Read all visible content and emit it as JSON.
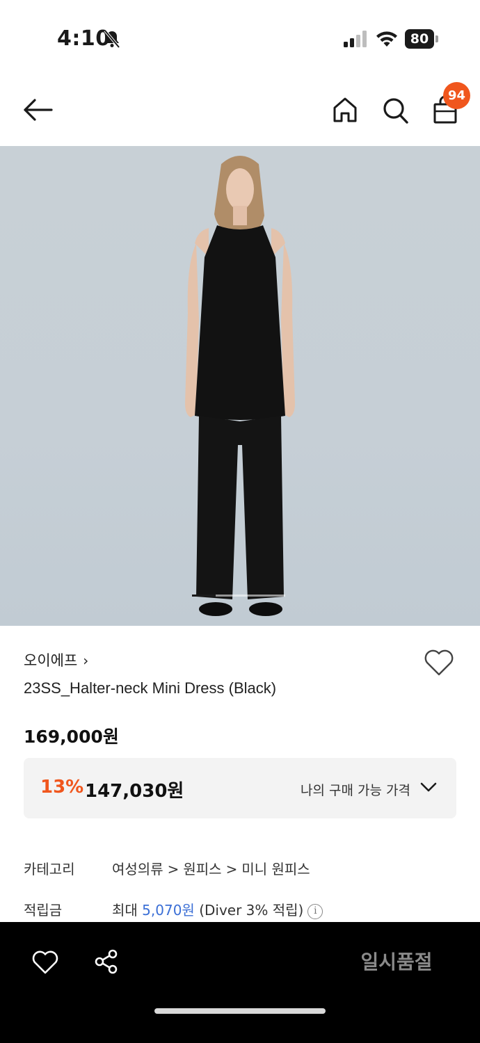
{
  "status_bar": {
    "time": "4:10",
    "battery": "80"
  },
  "header": {
    "cart_count": "94",
    "icons": [
      "arrow-left-icon",
      "home-icon",
      "search-icon",
      "shopping-bag-icon"
    ]
  },
  "product": {
    "brand": "오이에프",
    "name": "23SS_Halter-neck Mini Dress (Black)",
    "original_price": "169,000원",
    "discount_rate": "13%",
    "sale_price": "147,030원",
    "purchase_price_label": "나의 구매 가능 가격",
    "image_count_indicator": {
      "current_fraction": 0.25
    }
  },
  "info": {
    "category_label": "카테고리",
    "categories": [
      "여성의류",
      "원피스",
      "미니 원피스"
    ],
    "category_separator": ">",
    "points_label": "적립금",
    "points_prefix": "최대",
    "points_amount": "5,070원",
    "points_suffix": "(Diver 3% 적립)"
  },
  "bottom_bar": {
    "soldout_label": "일시품절"
  },
  "colors": {
    "accent": "#f0561d",
    "points_link": "#3b6fd6",
    "bottom_bar": "#000000"
  }
}
